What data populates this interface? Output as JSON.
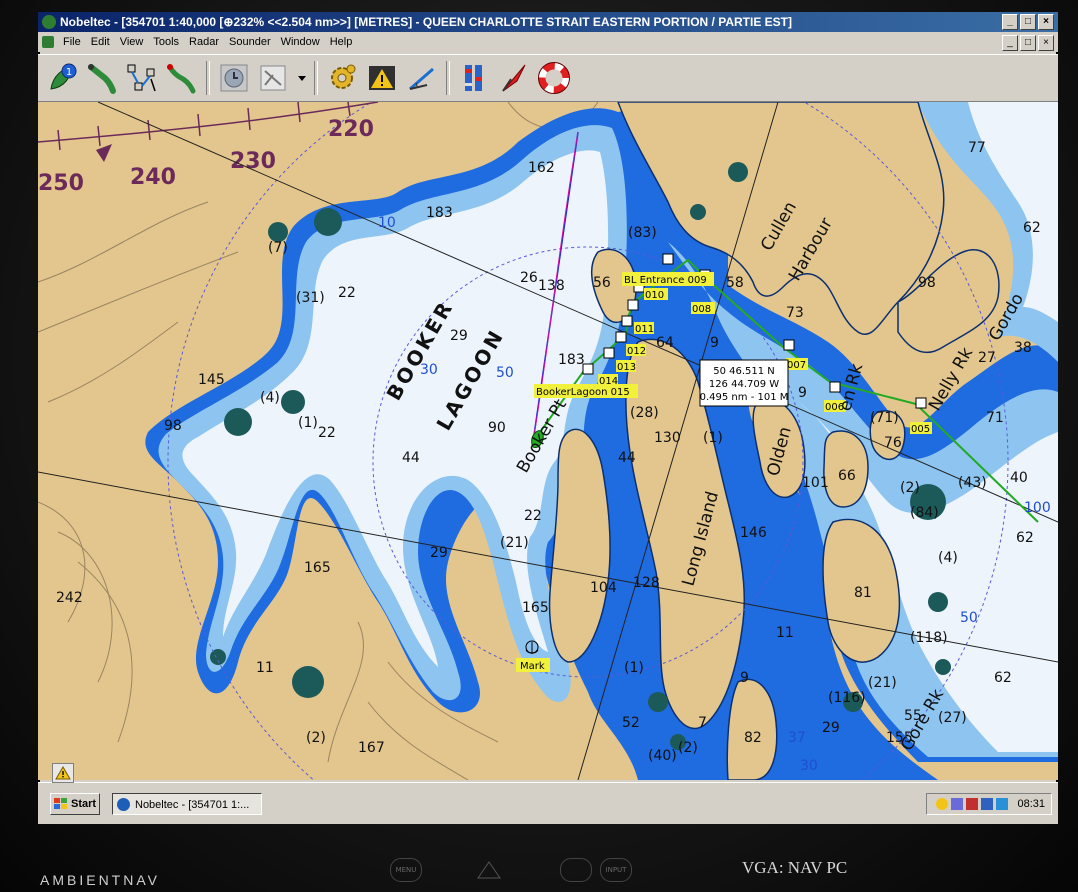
{
  "window": {
    "title": "Nobeltec - [354701 1:40,000 [⊕232% <<2.504 nm>>] [METRES] - QUEEN CHARLOTTE STRAIT EASTERN PORTION / PARTIE EST]",
    "controls": [
      "_",
      "□",
      "×"
    ]
  },
  "menu": {
    "items": [
      "File",
      "Edit",
      "View",
      "Tools",
      "Radar",
      "Sounder",
      "Window",
      "Help"
    ]
  },
  "toolbar": {
    "icons": [
      "vessel-icon",
      "route-icon",
      "track-icon",
      "leg-icon",
      "clock-icon",
      "chart-tool-icon",
      "gear-icon",
      "warning-icon",
      "measure-icon",
      "tide-icon",
      "sail-icon",
      "lifebuoy-icon"
    ],
    "badge": "1"
  },
  "chart": {
    "labels": {
      "lagoon_1": "BOOKER",
      "lagoon_2": "LAGOON",
      "harbour_1": "Cullen",
      "harbour_2": "Harbour",
      "long_island": "Long Island",
      "olden": "Olden",
      "booker_pt": "Booker Pt",
      "gore_rk": "Gore Rk",
      "nelly": "Nelly Rk",
      "gordon": "Gordo",
      "olden_rk": "en Rk",
      "mark": "Mark"
    },
    "bearings": [
      "250",
      "240",
      "230",
      "220"
    ],
    "waypoints": [
      "BL Entrance 009",
      "010",
      "008",
      "011",
      "012",
      "013",
      "014",
      "BookerLagoon 015",
      "007",
      "006",
      "005"
    ],
    "cursor": {
      "lat": "50 46.511 N",
      "lon": "126 44.709 W",
      "range": "0.495 nm - 101 M"
    },
    "depths": {
      "d162": "162",
      "d183": "183",
      "d10": "10",
      "d71": "(7)",
      "d22a": "22",
      "d31": "(31)",
      "d145": "145",
      "d98": "98",
      "d4": "(4)",
      "d11a": "(1)",
      "d22b": "22",
      "d29a": "29",
      "d30": "30",
      "d50": "50",
      "d90": "90",
      "d44": "44",
      "d26": "26",
      "d138": "138",
      "d183b": "183",
      "d29b": "29",
      "d22c": "22",
      "d21": "(21)",
      "d165a": "165",
      "d165b": "165",
      "d11b": "11",
      "d2a": "(2)",
      "d167": "167",
      "d83": "(83)",
      "d56": "56",
      "d64": "64",
      "d28": "(28)",
      "d130": "130",
      "d1a": "(1)",
      "d44b": "44",
      "d104": "104",
      "d128": "128",
      "d1b": "(1)",
      "d52": "52",
      "d40": "(40)",
      "d2b": "(2)",
      "d7": "7",
      "d82": "82",
      "d58": "58",
      "d73": "73",
      "d9a": "9",
      "d9b": "9",
      "d101": "101",
      "d146": "146",
      "d11c": "11",
      "d9c": "9",
      "d37": "37",
      "d30b": "30",
      "d29c": "29",
      "d116": "(116)",
      "d21b": "(21)",
      "d155": "155",
      "d55": "55",
      "d66": "66",
      "d76": "76",
      "d81": "81",
      "d118": "(118)",
      "d84": "(84)",
      "d71b": "(71)",
      "d2c": "(2)",
      "d4b": "(4)",
      "d43": "(43)",
      "d50b": "50",
      "d62a": "62",
      "d62b": "62",
      "d40b": "40",
      "d100": "100",
      "d38": "38",
      "d27": "27",
      "d71c": "71",
      "d77": "77",
      "d62c": "62",
      "d98b": "98",
      "d242": "242",
      "d27b": "(27)"
    }
  },
  "taskbar": {
    "start": "Start",
    "task": "Nobeltec - [354701 1:...",
    "clock": "08:31"
  },
  "hardware": {
    "brand": "AMBIENTNAV",
    "label": "VGA: NAV PC",
    "btn1": "MENU",
    "btn2": "INPUT"
  }
}
